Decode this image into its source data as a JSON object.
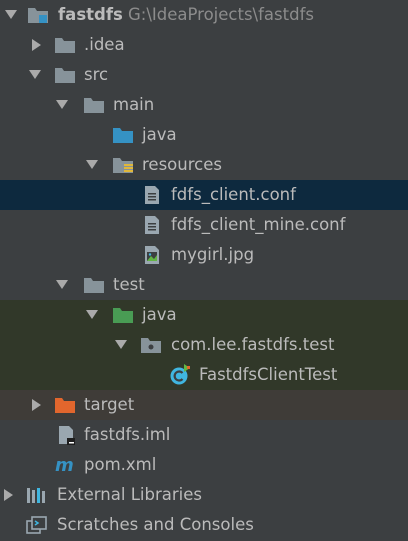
{
  "colors": {
    "background": "#3c3f41",
    "selected_row": "#0d293e",
    "test_rows": "#313829",
    "excluded_row": "#3f3c38",
    "folder": "#87939a",
    "source_folder": "#3592c4",
    "test_folder": "#499c54",
    "excluded_folder": "#e2662d",
    "text": "#bbbbbb",
    "path_text": "#8c8c8c"
  },
  "tree": {
    "project": {
      "name": "fastdfs",
      "path": "G:\\IdeaProjects\\fastdfs"
    },
    "idea": "idea",
    "src": "src",
    "main": "main",
    "main_java": "java",
    "resources": "resources",
    "fdfs_client_conf": "fdfs_client.conf",
    "fdfs_client_mine_conf": "fdfs_client_mine.conf",
    "mygirl_jpg": "mygirl.jpg",
    "test": "test",
    "test_java": "java",
    "package": "com.lee.fastdfs.test",
    "test_class": "FastdfsClientTest",
    "target": "target",
    "iml": "fastdfs.iml",
    "pom": "pom.xml",
    "external_libraries": "External Libraries",
    "scratches": "Scratches and Consoles"
  }
}
